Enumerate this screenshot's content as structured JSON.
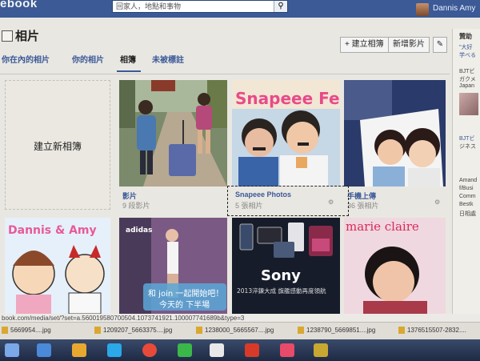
{
  "header": {
    "logo": "ebook",
    "search_text": "回家人，地點和事物",
    "profile_name": "Dannis Amy"
  },
  "page": {
    "title": "相片",
    "create_album_btn": "+ 建立相簿",
    "add_photos_btn": "新增影片",
    "edit_btn": "✎"
  },
  "tabs": [
    {
      "label": "你在內的相片"
    },
    {
      "label": "你的相片"
    },
    {
      "label": "相簿"
    },
    {
      "label": "未被標註"
    }
  ],
  "create_album_label": "建立新相簿",
  "albums": [
    {
      "title": "影片",
      "count": "9 段影片"
    },
    {
      "title": "Snapeee Photos",
      "count": "5 張相片"
    },
    {
      "title": "手機上傳",
      "count": "36 張相片"
    }
  ],
  "thumb_text": {
    "snapeee": "Snapeee Fes",
    "dannis_amy": "Dannis & Amy",
    "adidas": "adidas",
    "join_text": "和 join 一起開始吧！",
    "join_sub": "今天的 下半場",
    "sony": "Sony",
    "sony_sub": "2013淬鍊大成 旗艦感動再度領航",
    "marie": "marie claire"
  },
  "right_column": {
    "heading": "贊助",
    "lines": [
      "\"大好",
      "学べる",
      "BJTビ",
      "ガクメ",
      "Japan",
      "BJTビ",
      "ジネス",
      "Amand",
      "f/Busi",
      "Comm",
      "Bestk",
      "日相處"
    ]
  },
  "status_url": "book.com/media/set/?set=a.560019580700504.1073741921.100007741689b&type=3",
  "downloads": [
    "5669954....jpg",
    "1209207_5663375....jpg",
    "1238000_5665567....jpg",
    "1238790_5669851....jpg",
    "1376515507-2832...."
  ],
  "colors": {
    "facebook_blue": "#3b5a96",
    "link_blue": "#3b5998"
  }
}
